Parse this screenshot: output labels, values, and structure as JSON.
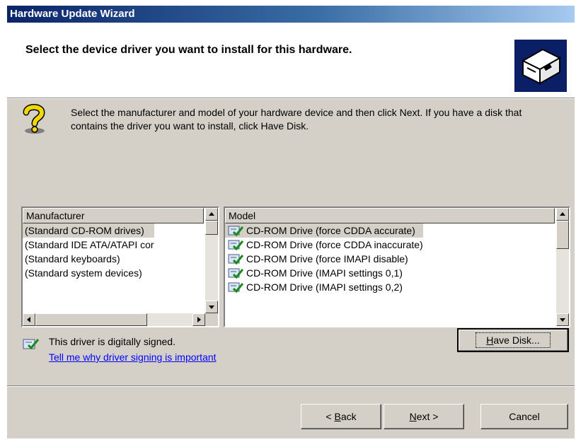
{
  "window": {
    "title": "Hardware Update Wizard"
  },
  "header": {
    "title": "Select the device driver you want to install for this hardware."
  },
  "instructions": "Select the manufacturer and model of your hardware device and then click Next. If you have a disk that contains the driver you want to install, click Have Disk.",
  "manufacturer": {
    "header": "Manufacturer",
    "items": [
      "(Standard CD-ROM drives)",
      "(Standard IDE ATA/ATAPI cor",
      "(Standard keyboards)",
      "(Standard system devices)"
    ],
    "selected_index": 0
  },
  "model": {
    "header": "Model",
    "items": [
      "CD-ROM Drive (force CDDA accurate)",
      "CD-ROM Drive (force CDDA inaccurate)",
      "CD-ROM Drive (force IMAPI disable)",
      "CD-ROM Drive (IMAPI settings 0,1)",
      "CD-ROM Drive (IMAPI settings 0,2)"
    ],
    "selected_index": 0
  },
  "signing": {
    "status": "This driver is digitally signed.",
    "link": "Tell me why driver signing is important"
  },
  "buttons": {
    "have_disk": {
      "mnemonic": "H",
      "rest": "ave Disk..."
    },
    "back": {
      "prefix": "< ",
      "mnemonic": "B",
      "rest": "ack"
    },
    "next": {
      "mnemonic": "N",
      "rest": "ext >"
    },
    "cancel": "Cancel"
  },
  "colors": {
    "dialog_face": "#d4d0c8",
    "title_gradient_start": "#0a246a",
    "title_gradient_end": "#a6caf0",
    "link": "#0000ff",
    "header_icon_bg": "#0b1f66"
  },
  "icons": {
    "header": "hardware-box-icon",
    "help": "question-mark-icon",
    "signed": "signed-certificate-icon"
  }
}
